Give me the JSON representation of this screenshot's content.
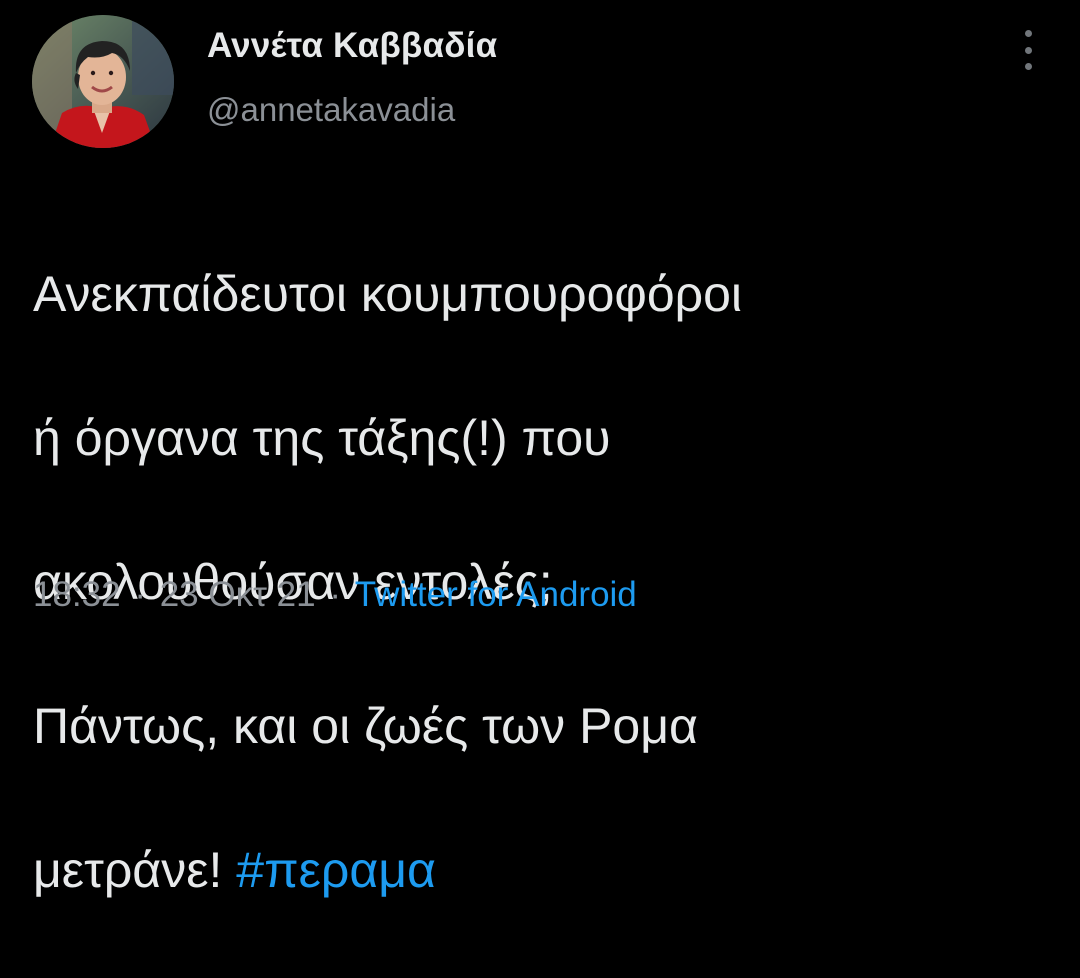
{
  "author": {
    "display_name": "Αννέτα Καββαδία",
    "handle": "@annetakavadia"
  },
  "tweet": {
    "lines": [
      "Ανεκπαίδευτοι κουμπουροφόροι",
      "ή όργανα της τάξης(!) που",
      "ακολουθούσαν εντολές;",
      "Πάντως, και οι ζωές των Ρομα"
    ],
    "last_line_text": "μετράνε! ",
    "hashtag": "#περαμα"
  },
  "meta": {
    "time": "18:32",
    "separator": "·",
    "date": "23 Οκτ 21",
    "source": "Twitter for Android"
  },
  "icons": {
    "more": "more-vertical-icon"
  },
  "colors": {
    "background": "#000000",
    "text": "#e7e9ea",
    "secondary_text": "#8b9096",
    "accent": "#1d9bf0"
  }
}
